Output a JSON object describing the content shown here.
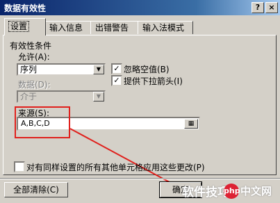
{
  "window": {
    "title": "数据有效性",
    "help_glyph": "?",
    "close_glyph": "×"
  },
  "tabs": [
    {
      "label": "设置"
    },
    {
      "label": "输入信息"
    },
    {
      "label": "出错警告"
    },
    {
      "label": "输入法模式"
    }
  ],
  "settings": {
    "group_label": "有效性条件",
    "allow_label": "允许(A):",
    "allow_value": "序列",
    "data_label": "数据(D):",
    "data_value": "介于",
    "ignore_blank_label": "忽略空值(B)",
    "ignore_blank_checked": true,
    "dropdown_label": "提供下拉箭头(I)",
    "dropdown_checked": true,
    "source_label": "来源(S):",
    "source_value": "A,B,C,D",
    "apply_all_label": "对有同样设置的所有其他单元格应用这些更改(P)",
    "apply_all_checked": false
  },
  "buttons": {
    "clear_all": "全部清除(C)",
    "ok": "确定"
  },
  "watermark": {
    "text1": "软件技巧",
    "text2": "中文网",
    "badge": "php"
  },
  "colors": {
    "highlight": "#e0201c"
  }
}
